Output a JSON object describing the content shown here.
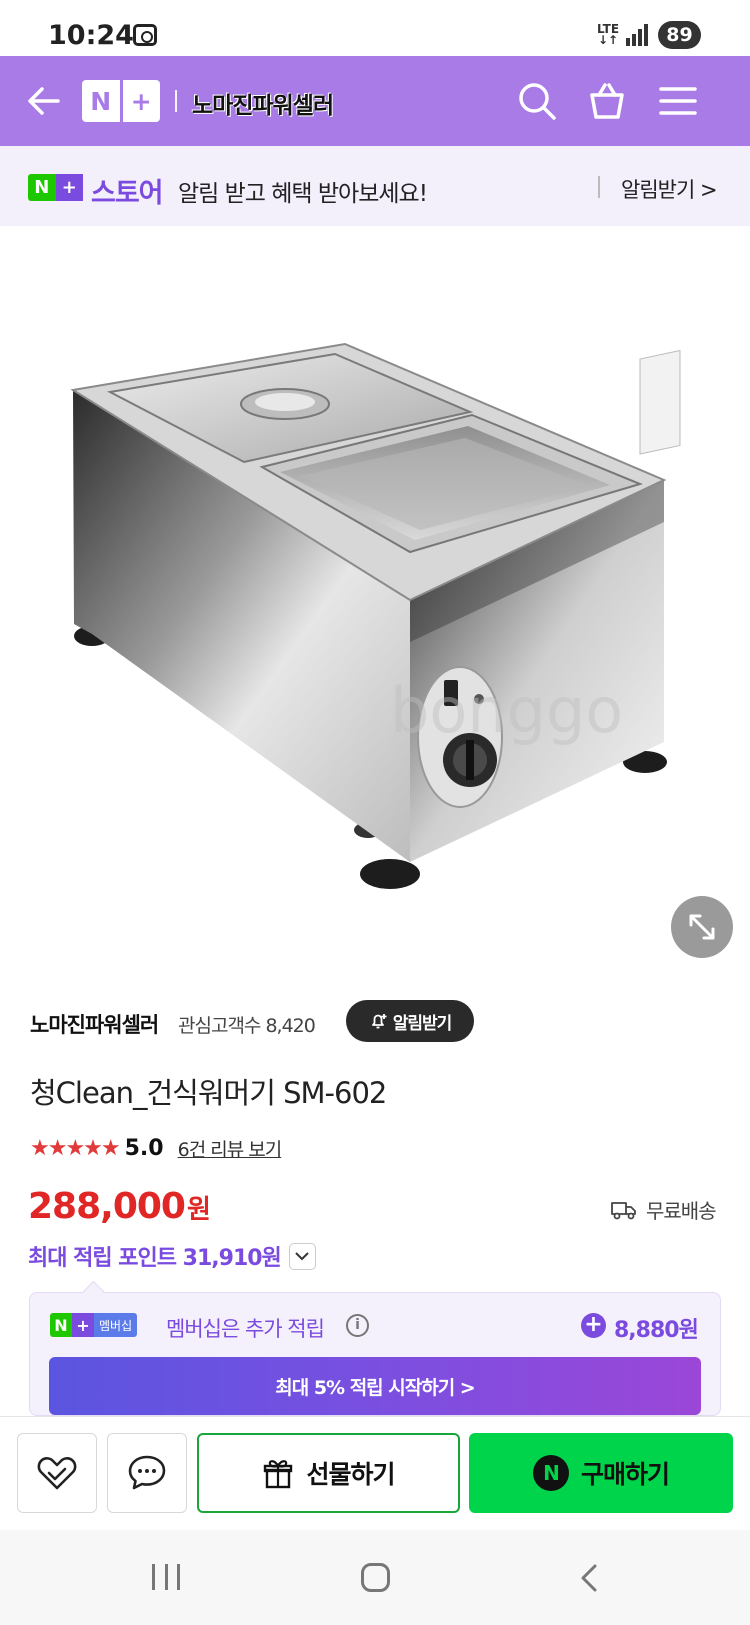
{
  "status_bar": {
    "time": "10:24",
    "network": "LTE",
    "battery": "89"
  },
  "header": {
    "logo_left": "N",
    "logo_right": "+",
    "seller_name": "노마진파워셀러",
    "accent_color": "#a87be6"
  },
  "store_banner": {
    "badge_left": "N",
    "badge_right": "+",
    "store_label": "스토어",
    "message": "알림 받고 혜택 받아보세요!",
    "cta": "알림받기 >"
  },
  "product": {
    "image_watermark": "bonggo",
    "seller": "노마진파워셀러",
    "followers_label": "관심고객수 8,420",
    "notify_label": "알림받기",
    "title": "청Clean_건식워머기 SM-602",
    "stars": "★★★★★",
    "rating": "5.0",
    "reviews_link": "6건 리뷰 보기",
    "price": "288,000",
    "currency": "원",
    "shipping": "무료배송",
    "points": "최대 적립 포인트 31,910원",
    "price_color": "#e12626",
    "point_color": "#7b4be0"
  },
  "membership": {
    "badge_n": "N",
    "badge_plus": "+",
    "badge_text": "멤버십",
    "text": "멤버십은 추가 적립",
    "info_glyph": "i",
    "plus_glyph": "+",
    "amount": "8,880원",
    "button": "최대 5% 적립 시작하기 >"
  },
  "action_bar": {
    "gift_label": "선물하기",
    "buy_badge": "N",
    "buy_label": "구매하기",
    "buy_color": "#00d44a"
  }
}
